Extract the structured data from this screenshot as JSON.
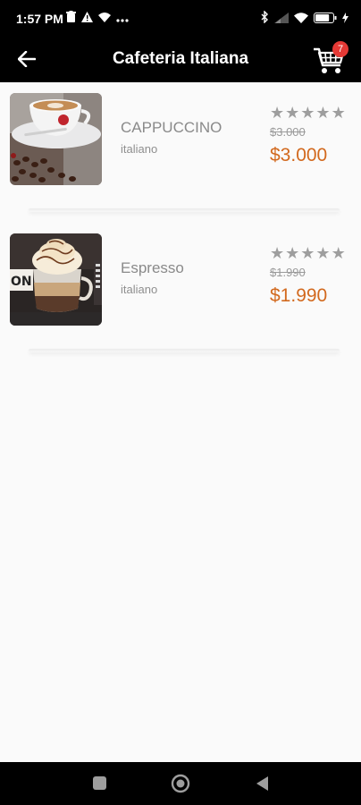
{
  "status_bar": {
    "time": "1:57 PM",
    "battery_level": 0.8,
    "icons": [
      "delete-icon",
      "warning-icon",
      "wifi-icon",
      "more-dots-icon",
      "bluetooth-icon",
      "signal-icon",
      "wifi-icon",
      "battery-icon",
      "charging-icon"
    ]
  },
  "app_bar": {
    "title": "Cafeteria Italiana",
    "back_icon": "arrow-left-icon",
    "cart_icon": "shopping-cart-icon",
    "cart_count": "7"
  },
  "products": [
    {
      "name": "CAPPUCCINO",
      "subtitle": "italiano",
      "old_price": "$3.000",
      "price": "$3.000",
      "rating": 0,
      "rating_max": 5
    },
    {
      "name": "Espresso",
      "subtitle": "italiano",
      "old_price": "$1.990",
      "price": "$1.990",
      "rating": 0,
      "rating_max": 5
    }
  ],
  "nav_bar": {
    "icons": [
      "recents-square-icon",
      "home-circle-icon",
      "back-triangle-icon"
    ]
  },
  "colors": {
    "bar_background": "#000000",
    "page_background": "#fafafa",
    "price": "#d2691e",
    "badge": "#e53935",
    "star": "#9e9e9e"
  }
}
